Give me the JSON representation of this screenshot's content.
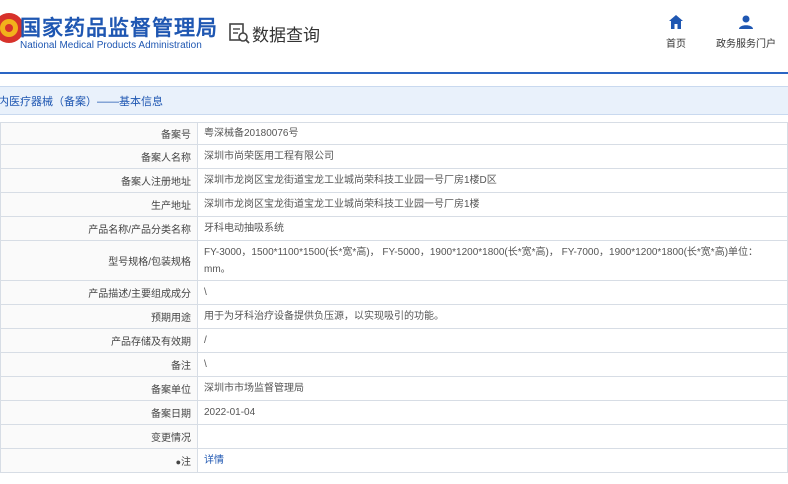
{
  "header": {
    "brand_cn": "国家药品监督管理局",
    "brand_en": "National Medical Products Administration",
    "page_title": "数据查询",
    "nav": [
      {
        "label": "首页",
        "icon": "home-icon"
      },
      {
        "label": "政务服务门户",
        "icon": "user-icon"
      }
    ]
  },
  "breadcrumb": "内医疗器械（备案）——基本信息",
  "colors": {
    "accent": "#1f57b2",
    "crumb_bg": "#e9f1fb",
    "border": "#d7dde5"
  },
  "detail": {
    "rows": [
      {
        "label": "备案号",
        "value": "粤深械备20180076号"
      },
      {
        "label": "备案人名称",
        "value": "深圳市尚荣医用工程有限公司"
      },
      {
        "label": "备案人注册地址",
        "value": "深圳市龙岗区宝龙街道宝龙工业城尚荣科技工业园一号厂房1楼D区"
      },
      {
        "label": "生产地址",
        "value": "深圳市龙岗区宝龙街道宝龙工业城尚荣科技工业园一号厂房1楼"
      },
      {
        "label": "产品名称/产品分类名称",
        "value": "牙科电动抽吸系统"
      },
      {
        "label": "型号规格/包装规格",
        "value": "FY-3000，1500*1100*1500(长*宽*高)， FY-5000，1900*1200*1800(长*宽*高)， FY-7000，1900*1200*1800(长*宽*高)单位：mm。"
      },
      {
        "label": "产品描述/主要组成成分",
        "value": "\\"
      },
      {
        "label": "预期用途",
        "value": "用于为牙科治疗设备提供负压源，以实现吸引的功能。"
      },
      {
        "label": "产品存储及有效期",
        "value": "/"
      },
      {
        "label": "备注",
        "value": "\\"
      },
      {
        "label": "备案单位",
        "value": "深圳市市场监督管理局"
      },
      {
        "label": "备案日期",
        "value": "2022-01-04"
      },
      {
        "label": "变更情况",
        "value": ""
      },
      {
        "label": "注",
        "value": "详情"
      }
    ]
  }
}
